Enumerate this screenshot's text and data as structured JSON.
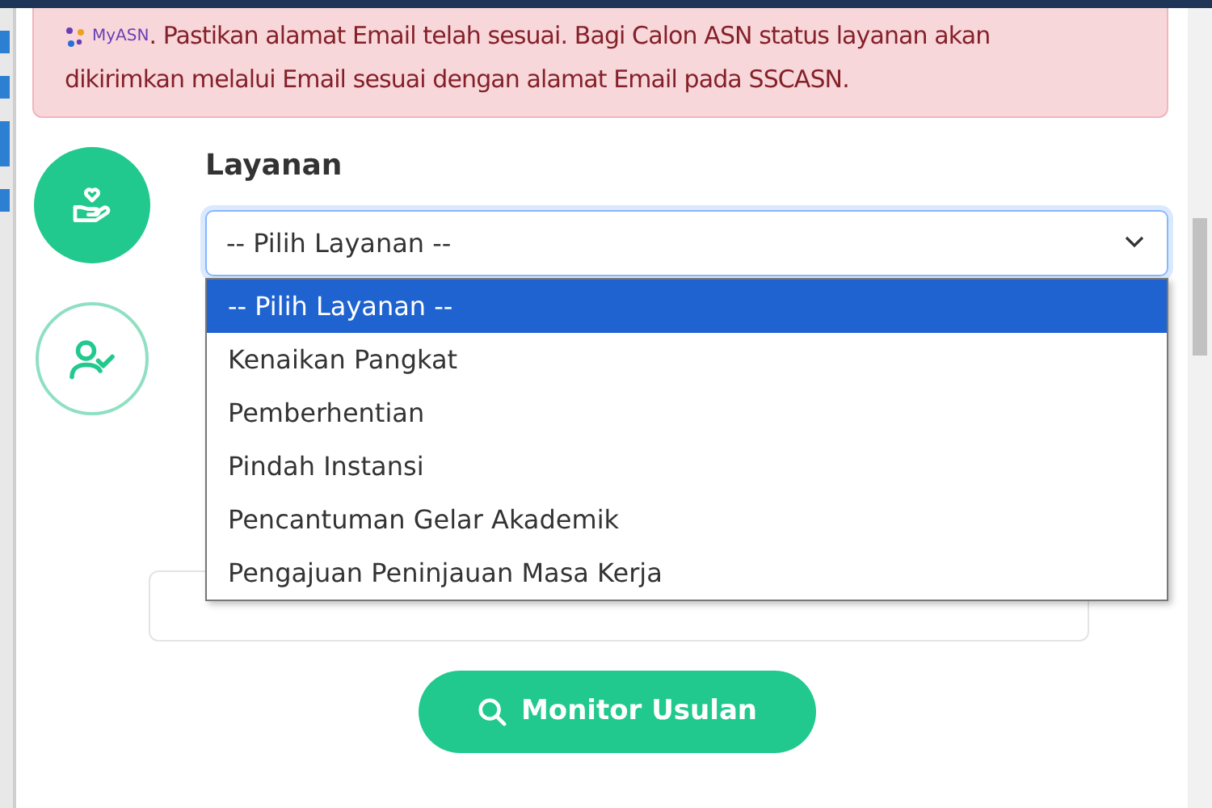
{
  "alert": {
    "logo_text": "MyASN",
    "message": ". Pastikan alamat Email telah sesuai. Bagi Calon ASN status layanan akan dikirimkan melalui Email sesuai dengan alamat Email pada SSCASN."
  },
  "service_field": {
    "label": "Layanan",
    "value": "-- Pilih Layanan --",
    "expanded": true
  },
  "dropdown_options": [
    {
      "label": "-- Pilih Layanan --",
      "selected": true
    },
    {
      "label": "Kenaikan Pangkat",
      "selected": false
    },
    {
      "label": "Pemberhentian",
      "selected": false
    },
    {
      "label": "Pindah Instansi",
      "selected": false
    },
    {
      "label": "Pencantuman Gelar Akademik",
      "selected": false
    },
    {
      "label": "Pengajuan Peninjauan Masa Kerja",
      "selected": false
    }
  ],
  "steps": [
    {
      "kind": "service",
      "active": true
    },
    {
      "kind": "verify",
      "active": false
    }
  ],
  "submit_button": {
    "label": "Monitor Usulan"
  }
}
